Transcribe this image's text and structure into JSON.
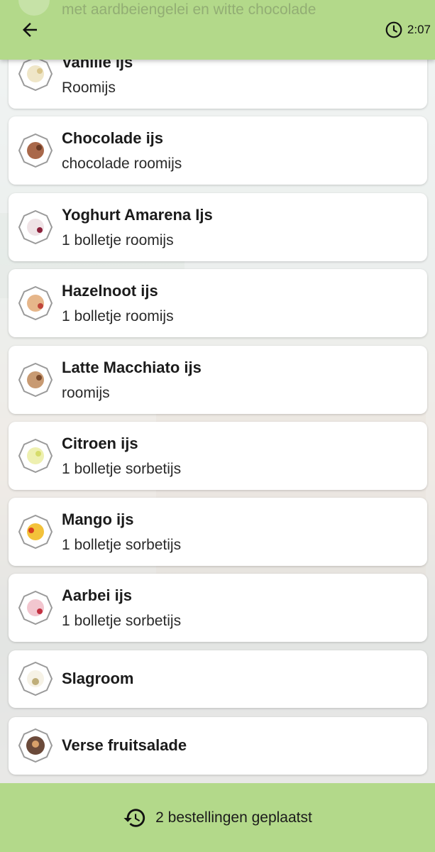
{
  "header": {
    "ghost_text": "met aardbeiengelei en witte chocolade",
    "timer": "2:07"
  },
  "items": [
    {
      "name": "Vanille ijs",
      "desc": "Roomijs",
      "color": "#efe6c8",
      "accent": "#d9c58a"
    },
    {
      "name": "Chocolade ijs",
      "desc": "chocolade roomijs",
      "color": "#a9684a",
      "accent": "#6b3b26"
    },
    {
      "name": "Yoghurt Amarena Ijs",
      "desc": "1 bolletje roomijs",
      "color": "#efe3e6",
      "accent": "#8b1f3a"
    },
    {
      "name": "Hazelnoot ijs",
      "desc": "1 bolletje roomijs",
      "color": "#e6b68a",
      "accent": "#c0453a"
    },
    {
      "name": "Latte Macchiato ijs",
      "desc": "roomijs",
      "color": "#c89a72",
      "accent": "#7a4a2c"
    },
    {
      "name": "Citroen ijs",
      "desc": "1 bolletje sorbetijs",
      "color": "#eef0b0",
      "accent": "#d6dc6a"
    },
    {
      "name": "Mango ijs",
      "desc": "1 bolletje sorbetijs",
      "color": "#f3c23a",
      "accent": "#d8401f"
    },
    {
      "name": "Aarbei ijs",
      "desc": "1 bolletje sorbetijs",
      "color": "#f2c6cf",
      "accent": "#c23040"
    },
    {
      "name": "Slagroom",
      "desc": "",
      "color": "#f6f2e6",
      "accent": "#bfae7a"
    },
    {
      "name": "Verse fruitsalade",
      "desc": "",
      "color": "#6b4a3a",
      "accent": "#d8a06a"
    }
  ],
  "footer": {
    "label": "2 bestellingen geplaatst"
  }
}
